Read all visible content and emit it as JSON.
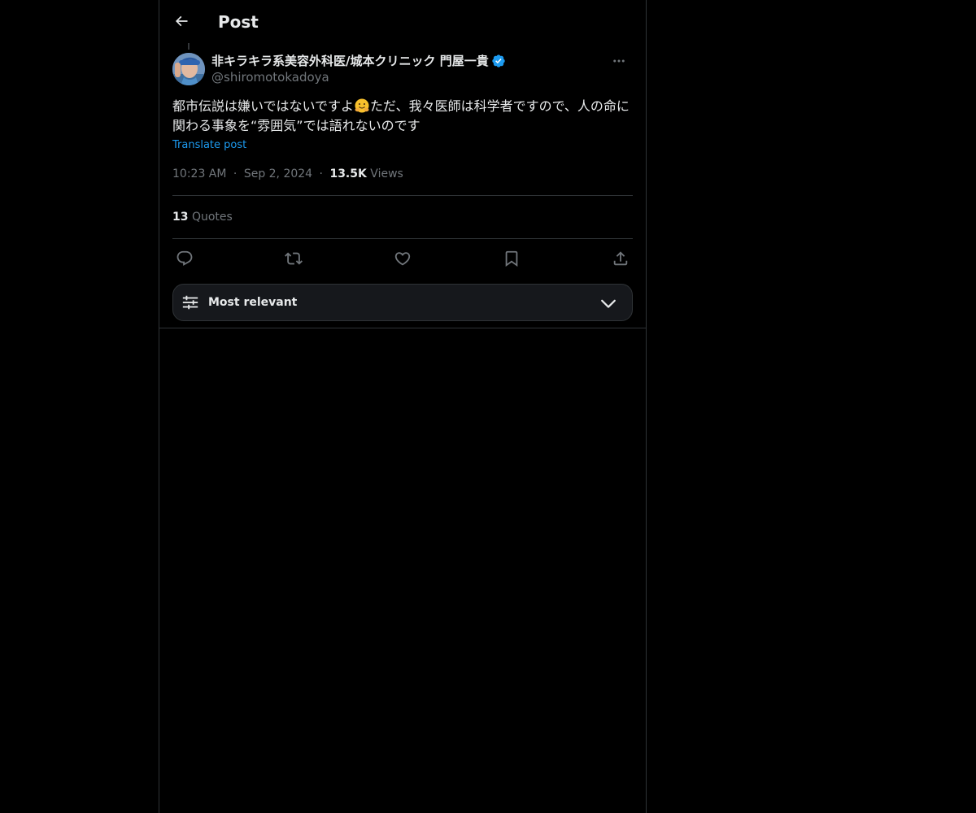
{
  "header": {
    "title": "Post",
    "back_icon": "arrow-left-icon"
  },
  "post": {
    "author": {
      "display_name": "非キラキラ系美容外科医/城本クリニック 門屋一貴",
      "handle": "@shiromotokadoya",
      "verified": true,
      "avatar_icon": "avatar"
    },
    "text_part1": "都市伝説は嫌いではないですよ",
    "emoji": "hugging-face-emoji",
    "text_part2": "ただ、我々医師は科学者ですので、人の命に関わる事象を“雰囲気”では語れないのです",
    "translate_label": "Translate post",
    "time": "10:23 AM",
    "separator": "·",
    "date": "Sep 2, 2024",
    "views_count": "13.5K",
    "views_label": "Views",
    "quotes_count": "13",
    "quotes_label": "Quotes"
  },
  "actions": [
    {
      "name": "reply",
      "icon": "reply-icon"
    },
    {
      "name": "repost",
      "icon": "repost-icon"
    },
    {
      "name": "like",
      "icon": "heart-icon"
    },
    {
      "name": "bookmark",
      "icon": "bookmark-icon"
    },
    {
      "name": "share",
      "icon": "share-icon"
    }
  ],
  "sort": {
    "label": "Most relevant",
    "icon": "sliders-icon",
    "chevron": "chevron-down-icon"
  },
  "colors": {
    "background": "#000000",
    "text": "#e7e9ea",
    "secondary": "#71767b",
    "accent": "#1d9bf0",
    "border": "#2f3336"
  }
}
